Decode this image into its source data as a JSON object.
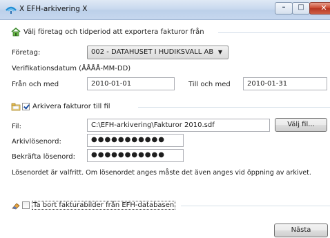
{
  "window": {
    "title": "X EFH-arkivering X",
    "minimize_glyph": "–",
    "maximize_glyph": "□",
    "close_glyph": "✕"
  },
  "export_section": {
    "title": "Välj företag och tidperiod att exportera fakturor från",
    "company_label": "Företag:",
    "company_value": "002 - DATAHUSET  I HUDIKSVALL AB",
    "combo_arrow": "▼",
    "date_format_label": "Verifikationsdatum (ÅÅÅÅ-MM-DD)",
    "from_label": "Från och med",
    "from_value": "2010-01-01",
    "to_label": "Till och med",
    "to_value": "2010-01-31"
  },
  "archive_section": {
    "checkbox_label": "Arkivera fakturor till fil",
    "checked": true,
    "file_label": "Fil:",
    "file_value": "C:\\EFH-arkivering\\Fakturor 2010.sdf",
    "choose_file_button": "Välj fil...",
    "password_label": "Arkivlösenord:",
    "password_value": "●●●●●●●●●●●",
    "confirm_label": "Bekräfta lösenord:",
    "confirm_value": "●●●●●●●●●●●",
    "info_text": "Lösenordet är valfritt. Om lösenordet anges måste det även anges vid öppning av arkivet."
  },
  "delete_section": {
    "checkbox_label": "Ta bort fakturabilder från EFH-databasen",
    "checked": false
  },
  "footer": {
    "next_button": "Nästa"
  },
  "colors": {
    "accent": "#1c4fa3",
    "titlebar": "#c9d9ee",
    "close_button": "#c8442c"
  }
}
